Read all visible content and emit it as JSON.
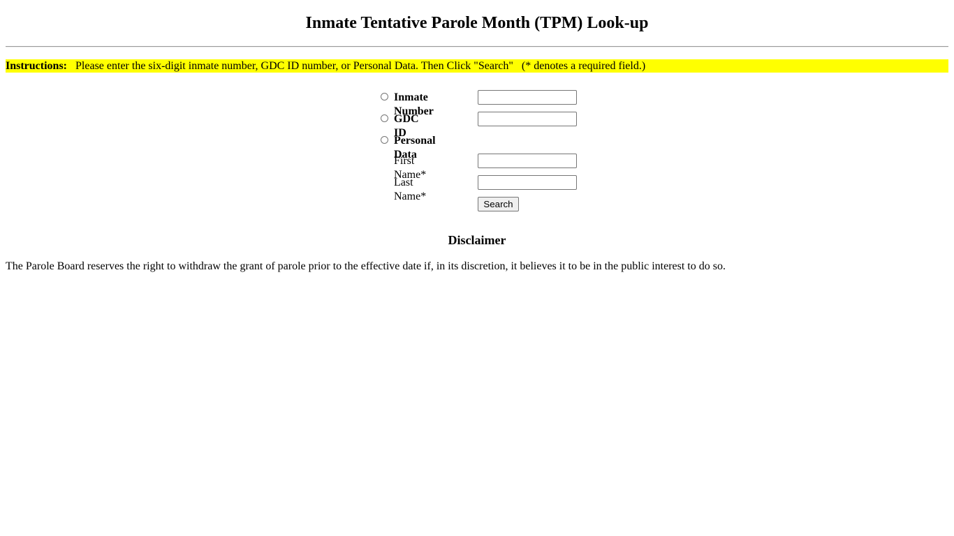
{
  "page": {
    "title": "Inmate Tentative Parole Month (TPM) Look-up"
  },
  "instructions": {
    "label": "Instructions:",
    "text": "   Please enter the six-digit inmate number, GDC ID number, or Personal Data. Then Click \"Search\"   (* denotes a required field.)"
  },
  "form": {
    "options": [
      {
        "label": "Inmate Number",
        "selected": false,
        "value": "",
        "placeholder": ""
      },
      {
        "label": "GDC ID",
        "selected": false,
        "value": "",
        "placeholder": ""
      },
      {
        "label": "Personal Data",
        "selected": false
      }
    ],
    "first_name": {
      "label": "First Name*",
      "value": "",
      "placeholder": ""
    },
    "last_name": {
      "label": "Last Name*",
      "value": "",
      "placeholder": ""
    },
    "search_label": "Search"
  },
  "disclaimer": {
    "heading": "Disclaimer",
    "text": "The Parole Board reserves the right to withdraw the grant of parole prior to the effective date if, in its discretion, it believes it to be in the public interest to do so."
  },
  "colors": {
    "highlight": "#ffff00"
  }
}
